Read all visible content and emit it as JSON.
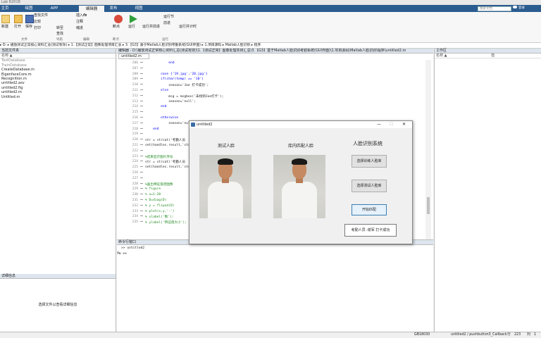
{
  "app": {
    "title_fragment": "Lab R2018"
  },
  "tabs": [
    "主页",
    "绘图",
    "APP",
    "编辑器",
    "发布",
    "视图"
  ],
  "active_tab": "编辑器",
  "search_placeholder": "搜索文档",
  "login": "登录",
  "ribbon": {
    "file": {
      "new": "新建",
      "open": "打开",
      "save": "保存",
      "find_files": "查找文件",
      "compare": "比较",
      "print": "打印",
      "group": "文件"
    },
    "nav": {
      "goto": "转至",
      "find": "查找",
      "group": "导航"
    },
    "edit": {
      "insert": "插入",
      "comment": "注释",
      "indent": "缩进",
      "fx": "fx",
      "group": "编辑"
    },
    "breakpoints": {
      "label": "断点",
      "group": "断点"
    },
    "run": {
      "run": "运行",
      "run_advance": "运行并前进",
      "run_section": "运行节",
      "advance": "前进",
      "run_timing": "运行并计时",
      "group": "运行"
    }
  },
  "pathbar": "▸ D: ▸ 播放测试正常核心资料汇总(测试有效) ▸ 1.【测试正常】图像处理项目汇总 ▸ 3.【G3】基于Matlab人脸识别考勤系统(GUI界面) ▸ 1.项目源码 ▸ Matlab人脸识别 ▸ 程序",
  "left_panel": {
    "header": "当前文件夹",
    "col_name": "名称 ▲",
    "files": [
      "TestDatabase",
      "TrainDatabase",
      "CreateDatabase.m",
      "EigenfaceCore.m",
      "Recognition.m",
      "untitled2.asv",
      "untitled2.fig",
      "untitled2.m",
      "Untitled.m"
    ],
    "details_header": "详细信息",
    "details_msg": "选择文件以查看详细信息"
  },
  "editor": {
    "header": "编辑器 - D:\\播放测试正常核心资料汇总(测试有效)\\1.【测试正常】图像处理项目汇总\\3.【G3】基于Matlab人脸识别考勤系统(GUI界面)\\1.项目源码\\Matlab人脸识别\\程序\\untitled2.m",
    "tab": "untitled2.m",
    "lines": [
      {
        "n": "206",
        "code": "            end"
      },
      {
        "n": "207",
        "code": ""
      },
      {
        "n": "208",
        "code": "        case {'19.jpg','20.jpg'}"
      },
      {
        "n": "209",
        "code": "        if(char(temp) == '10')"
      },
      {
        "n": "210",
        "code": "            season='Joe 打卡成功';"
      },
      {
        "n": "211",
        "code": "        else"
      },
      {
        "n": "212",
        "code": "            msg = msgbox('未找到Joe打卡');"
      },
      {
        "n": "213",
        "code": "            season='null';"
      },
      {
        "n": "214",
        "code": "        end"
      },
      {
        "n": "215",
        "code": ""
      },
      {
        "n": "216",
        "code": "        otherwise"
      },
      {
        "n": "217",
        "code": "            season='null';"
      },
      {
        "n": "218",
        "code": "    end"
      },
      {
        "n": "219",
        "code": ""
      },
      {
        "n": "220",
        "code": "str = strcat('考勤人员  ',"
      },
      {
        "n": "221",
        "code": "set(handles.result,'string',"
      },
      {
        "n": "222",
        "code": ""
      },
      {
        "n": "223",
        "code": "%结果显示图片序号"
      },
      {
        "n": "224",
        "code": "str = strcat('考勤人员  ',"
      },
      {
        "n": "225",
        "code": "set(handles.result,'string',"
      },
      {
        "n": "226",
        "code": ""
      },
      {
        "n": "227",
        "code": ""
      },
      {
        "n": "228",
        "code": "%画出特征值谱图像"
      },
      {
        "n": "229",
        "code": "% figure"
      },
      {
        "n": "230",
        "code": "% x=1:20"
      },
      {
        "n": "231",
        "code": "% D=diag(D)"
      },
      {
        "n": "232",
        "code": "% y = flipud(D)"
      },
      {
        "n": "233",
        "code": "% plot(x,y,'-')"
      },
      {
        "n": "234",
        "code": "% xlabel('数');"
      },
      {
        "n": "235",
        "code": "% ylabel('特征值大小');"
      }
    ]
  },
  "cmd": {
    "header": "命令行窗口",
    "line1": ">> untitled2",
    "prompt": "fx >>"
  },
  "workspace": {
    "header": "工作区",
    "col_name": "名称 ▲",
    "col_value": "值"
  },
  "figure": {
    "title": "untitled2",
    "label_test": "测试人脸",
    "label_match": "库内匹配人脸",
    "label_system": "人脸识别系统",
    "btn_train": "选择训练人脸库",
    "btn_test": "选择测试人脸库",
    "btn_match": "开始匹配",
    "result": "考勤人员 :谢军 打卡成功"
  },
  "status": {
    "encoding": "GB18030",
    "func": "untitled2 / pushbutton3_Callback",
    "row_label": "行",
    "row": "223",
    "col_label": "列",
    "col": "1"
  }
}
